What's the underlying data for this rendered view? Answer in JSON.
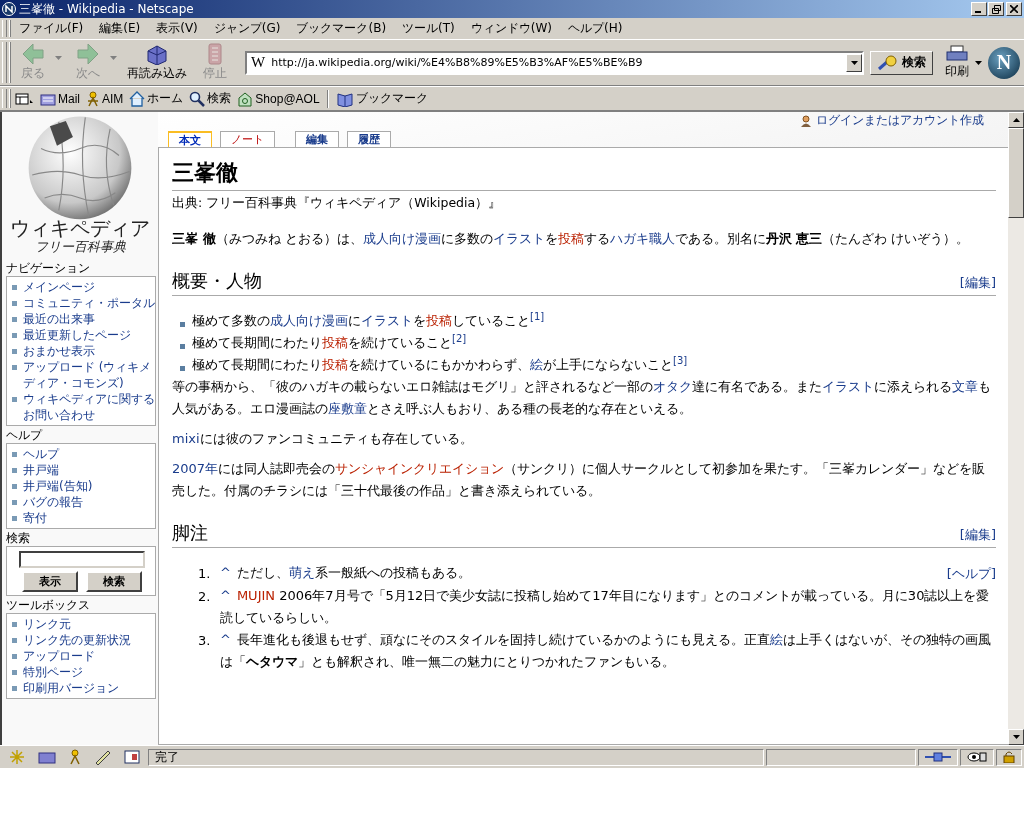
{
  "window": {
    "title": "三峯徹 - Wikipedia - Netscape"
  },
  "menu": [
    "ファイル(F)",
    "編集(E)",
    "表示(V)",
    "ジャンプ(G)",
    "ブックマーク(B)",
    "ツール(T)",
    "ウィンドウ(W)",
    "ヘルプ(H)"
  ],
  "nav_toolbar": {
    "buttons": [
      {
        "kind": "back",
        "label": "戻る",
        "disabled": true
      },
      {
        "kind": "forward",
        "label": "次へ",
        "disabled": true
      },
      {
        "kind": "reload",
        "label": "再読み込み",
        "disabled": false
      },
      {
        "kind": "stop",
        "label": "停止",
        "disabled": true
      }
    ],
    "site_icon": "W",
    "url": "http://ja.wikipedia.org/wiki/%E4%B8%89%E5%B3%AF%E5%BE%B9",
    "search_button": "検索",
    "print_button": "印刷",
    "logo_letter": "N"
  },
  "personal_toolbar": [
    {
      "kind": "mail",
      "label": "Mail"
    },
    {
      "kind": "aim",
      "label": "AIM"
    },
    {
      "kind": "home",
      "label": "ホーム"
    },
    {
      "kind": "search",
      "label": "検索"
    },
    {
      "kind": "shop",
      "label": "Shop@AOL"
    },
    {
      "kind": "bookmarks",
      "label": "ブックマーク"
    }
  ],
  "sidebar": {
    "logo_title": "ウィキペディア",
    "logo_tagline": "フリー百科事典",
    "portlets": [
      {
        "kind": "links",
        "title": "ナビゲーション",
        "items": [
          "メインページ",
          "コミュニティ・ポータル",
          "最近の出来事",
          "最近更新したページ",
          "おまかせ表示",
          "アップロード (ウィキメディア・コモンズ)",
          "ウィキペディアに関するお問い合わせ"
        ]
      },
      {
        "kind": "links",
        "title": "ヘルプ",
        "items": [
          "ヘルプ",
          "井戸端",
          "井戸端(告知)",
          "バグの報告",
          "寄付"
        ]
      },
      {
        "kind": "search",
        "title": "検索",
        "buttons": [
          "表示",
          "検索"
        ]
      },
      {
        "kind": "links",
        "title": "ツールボックス",
        "items": [
          "リンク元",
          "リンク先の更新状況",
          "アップロード",
          "特別ページ",
          "印刷用バージョン"
        ]
      }
    ]
  },
  "user_link": "ログインまたはアカウント作成",
  "page_tabs": [
    {
      "label": "本文",
      "selected": true,
      "missing": false
    },
    {
      "label": "ノート",
      "selected": false,
      "missing": true
    }
  ],
  "action_tabs": [
    {
      "label": "編集",
      "selected": false
    },
    {
      "label": "履歴",
      "selected": false
    }
  ],
  "article": {
    "title": "三峯徹",
    "subtitle": "出典: フリー百科事典『ウィキペディア（Wikipedia）』",
    "blocks": [
      {
        "kind": "paragraph",
        "segments": [
          {
            "kind": "bold",
            "text": "三峯 徹"
          },
          {
            "kind": "text",
            "text": "（みつみね とおる）は、"
          },
          {
            "kind": "link",
            "text": "成人向け漫画"
          },
          {
            "kind": "text",
            "text": "に多数の"
          },
          {
            "kind": "link",
            "text": "イラスト"
          },
          {
            "kind": "text",
            "text": "を"
          },
          {
            "kind": "redlink",
            "text": "投稿"
          },
          {
            "kind": "text",
            "text": "する"
          },
          {
            "kind": "link",
            "text": "ハガキ職人"
          },
          {
            "kind": "text",
            "text": "である。別名に"
          },
          {
            "kind": "bold",
            "text": "丹沢 恵三"
          },
          {
            "kind": "text",
            "text": "（たんざわ けいぞう）。"
          }
        ]
      },
      {
        "kind": "heading",
        "text": "概要・人物",
        "edit": "[編集]"
      },
      {
        "kind": "bullets",
        "items": [
          [
            {
              "kind": "text",
              "text": "極めて多数の"
            },
            {
              "kind": "link",
              "text": "成人向け漫画"
            },
            {
              "kind": "text",
              "text": "に"
            },
            {
              "kind": "link",
              "text": "イラスト"
            },
            {
              "kind": "text",
              "text": "を"
            },
            {
              "kind": "redlink",
              "text": "投稿"
            },
            {
              "kind": "text",
              "text": "していること"
            },
            {
              "kind": "ref",
              "text": "[1]"
            }
          ],
          [
            {
              "kind": "text",
              "text": "極めて長期間にわたり"
            },
            {
              "kind": "redlink",
              "text": "投稿"
            },
            {
              "kind": "text",
              "text": "を続けていること"
            },
            {
              "kind": "ref",
              "text": "[2]"
            }
          ],
          [
            {
              "kind": "text",
              "text": "極めて長期間にわたり"
            },
            {
              "kind": "redlink",
              "text": "投稿"
            },
            {
              "kind": "text",
              "text": "を続けているにもかかわらず、"
            },
            {
              "kind": "link",
              "text": "絵"
            },
            {
              "kind": "text",
              "text": "が上手にならないこと"
            },
            {
              "kind": "ref",
              "text": "[3]"
            }
          ]
        ]
      },
      {
        "kind": "paragraph",
        "segments": [
          {
            "kind": "text",
            "text": "等の事柄から、「彼のハガキの載らないエロ雑誌はモグリ」と評されるなど一部の"
          },
          {
            "kind": "link",
            "text": "オタク"
          },
          {
            "kind": "text",
            "text": "達に有名である。また"
          },
          {
            "kind": "link",
            "text": "イラスト"
          },
          {
            "kind": "text",
            "text": "に添えられる"
          },
          {
            "kind": "link",
            "text": "文章"
          },
          {
            "kind": "text",
            "text": "も人気がある。エロ漫画誌の"
          },
          {
            "kind": "link",
            "text": "座敷童"
          },
          {
            "kind": "text",
            "text": "とさえ呼ぶ人もおり、ある種の長老的な存在といえる。"
          }
        ]
      },
      {
        "kind": "paragraph",
        "segments": [
          {
            "kind": "link",
            "text": "mixi"
          },
          {
            "kind": "text",
            "text": "には彼のファンコミュニティも存在している。"
          }
        ]
      },
      {
        "kind": "paragraph",
        "segments": [
          {
            "kind": "link",
            "text": "2007年"
          },
          {
            "kind": "text",
            "text": "には同人誌即売会の"
          },
          {
            "kind": "redlink",
            "text": "サンシャインクリエイション"
          },
          {
            "kind": "text",
            "text": "（サンクリ）に個人サークルとして初参加を果たす。「三峯カレンダー」などを販売した。付属のチラシには「三十代最後の作品」と書き添えられている。"
          }
        ]
      },
      {
        "kind": "heading",
        "text": "脚注",
        "edit": "[編集]"
      },
      {
        "kind": "footnotes",
        "help": "[ヘルプ]",
        "items": [
          {
            "number": "1.",
            "segments": [
              {
                "kind": "backlink",
                "text": "^"
              },
              {
                "kind": "text",
                "text": "ただし、"
              },
              {
                "kind": "link",
                "text": "萌え"
              },
              {
                "kind": "text",
                "text": "系一般紙への投稿もある。"
              }
            ]
          },
          {
            "number": "2.",
            "segments": [
              {
                "kind": "backlink",
                "text": "^"
              },
              {
                "kind": "redlink",
                "text": "MUJIN"
              },
              {
                "kind": "text",
                "text": " 2006年7月号で「5月12日で美少女誌に投稿し始めて17年目になります」とのコメントが載っている。月に30誌以上を愛読しているらしい。"
              }
            ]
          },
          {
            "number": "3.",
            "segments": [
              {
                "kind": "backlink",
                "text": "^"
              },
              {
                "kind": "text",
                "text": "長年進化も後退もせず、頑なにそのスタイルを固持し続けているかのようにも見える。正直"
              },
              {
                "kind": "link",
                "text": "絵"
              },
              {
                "kind": "text",
                "text": "は上手くはないが、その独特の画風は「"
              },
              {
                "kind": "bold",
                "text": "ヘタウマ"
              },
              {
                "kind": "text",
                "text": "」とも解釈され、唯一無二の魅力にとりつかれたファンもいる。"
              }
            ]
          }
        ]
      }
    ]
  },
  "status_bar": {
    "text": "完了"
  }
}
